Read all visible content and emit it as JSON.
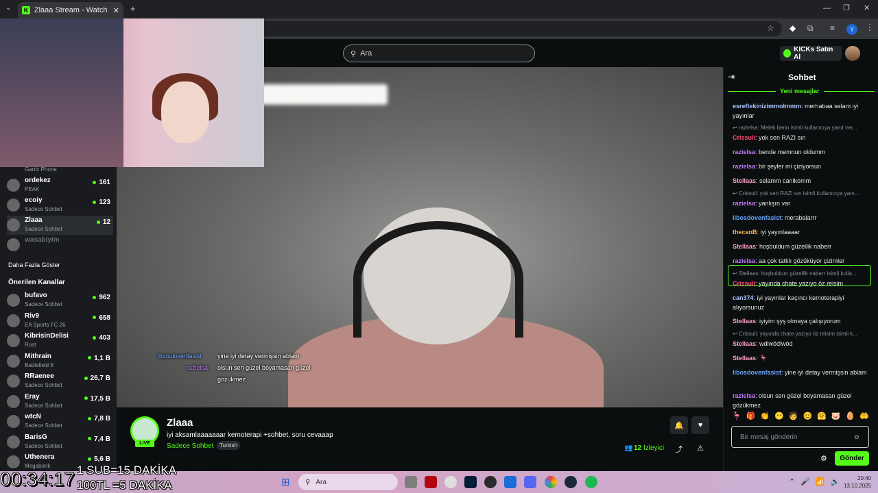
{
  "browser": {
    "tab_title": "Zlaaa Stream - Watch Live o",
    "new_tab": "+",
    "profile": "Y"
  },
  "header": {
    "search_placeholder": "Ara",
    "kicks_button": "KICKs Satın Al"
  },
  "sidebar": {
    "top_partial_game": "Gartic Phone",
    "followed": [
      {
        "name": "ordekez",
        "game": "PEAK",
        "viewers": "161"
      },
      {
        "name": "ecoiy",
        "game": "Sadece Sohbet",
        "viewers": "123"
      },
      {
        "name": "Zlaaa",
        "game": "Sadece Sohbet",
        "viewers": "12"
      },
      {
        "name": "wasabiyim",
        "game": "",
        "viewers": ""
      }
    ],
    "show_more": "Daha Fazla Göster",
    "recommended_title": "Önerilen Kanallar",
    "recommended": [
      {
        "name": "bufavo",
        "game": "Sadece Sohbet",
        "viewers": "962"
      },
      {
        "name": "Riv9",
        "game": "EA Sports FC 26",
        "viewers": "658"
      },
      {
        "name": "KibrisinDelisi",
        "game": "Rust",
        "viewers": "403"
      },
      {
        "name": "Mithrain",
        "game": "Battlefield 6",
        "viewers": "1,1 B"
      },
      {
        "name": "RRaenee",
        "game": "Sadece Sohbet",
        "viewers": "26,7 B"
      },
      {
        "name": "Eray",
        "game": "Sadece Sohbet",
        "viewers": "17,5 B"
      },
      {
        "name": "wtcN",
        "game": "Sadece Sohbet",
        "viewers": "7,8 B"
      },
      {
        "name": "BarisG",
        "game": "Sadece Sohbet",
        "viewers": "7,4 B"
      },
      {
        "name": "Uthenera",
        "game": "Megabonk",
        "viewers": "5,6 B"
      }
    ]
  },
  "video_overlay_chat": [
    {
      "user": "libosdovenfasist",
      "text": "yine iyi detay vermişsin ablam"
    },
    {
      "user": "razielsa",
      "text": "olsun sen güzel boyamasan güzel"
    },
    {
      "user": "",
      "text": "gozukmez"
    }
  ],
  "stream": {
    "name": "Zlaaa",
    "title": "iyi aksamlaaaaaaar kemoterapi +sohbet, soru cevaaap",
    "category": "Sadece Sohbet",
    "tag": "Turkish",
    "live": "LIVE",
    "viewers": "12",
    "viewers_label": "İzleyici"
  },
  "chat": {
    "title": "Sohbet",
    "new_messages": "Yeni mesajlar",
    "messages": [
      {
        "user": "esreftekinizimmolmmm",
        "color": "#a9c4ff",
        "text": "merhabaa selam iyi yayınlar"
      },
      {
        "reply": "razielsa: Melek benn isimli kullanıcıya yanıt ver..."
      },
      {
        "user": "Crissuli",
        "color": "#ff4d7a",
        "text": "yok sen RAZI sın"
      },
      {
        "user": "razielsa",
        "color": "#c57bff",
        "text": "bende memnun oldumm"
      },
      {
        "user": "razielsa",
        "color": "#c57bff",
        "text": "bir şeyler mi çiziyorsun"
      },
      {
        "user": "Stellaas",
        "color": "#ff9ec4",
        "text": "selamm canikomm"
      },
      {
        "reply": "Crissuli: yok sen RAZI sın isimli kullanıcıya yanı..."
      },
      {
        "user": "razielsa",
        "color": "#c57bff",
        "text": "yanlışın var"
      },
      {
        "user": "libosdovenfasist",
        "color": "#6aa7ff",
        "text": "merabalarrr"
      },
      {
        "user": "thecanB",
        "color": "#ffb347",
        "text": "iyi yayınlaaaar"
      },
      {
        "user": "Stellaas",
        "color": "#ff9ec4",
        "text": "hoşbuldum güzellik naberr"
      },
      {
        "user": "razielsa",
        "color": "#c57bff",
        "text": "aa çok tatklı gözüküyor çizimler"
      },
      {
        "reply": "Stellaas: hoşbuldum güzellik naberr isimli kulla..."
      },
      {
        "user": "Crissuli",
        "color": "#ff4d7a",
        "text": "yayında chate yazıyo öz reisim"
      },
      {
        "user": "can374",
        "color": "#a9c4ff",
        "text": "iyi yayınlar kaçıncı kemoterapiyi alıyorsunuz"
      },
      {
        "user": "Stellaas",
        "color": "#ff9ec4",
        "text": "iyiyim şyş olmaya çalışıyorum"
      },
      {
        "reply": "Crissuli: yayında chate yazıyo öz reisim isimli k..."
      },
      {
        "user": "Stellaas",
        "color": "#ff9ec4",
        "text": "wdlwödlwöd"
      },
      {
        "user": "Stellaas",
        "color": "#ff9ec4",
        "text": "🦩"
      },
      {
        "user": "libosdovenfasist",
        "color": "#6aa7ff",
        "text": "yine iyi detay vermişsin ablam"
      },
      {
        "user": "razielsa",
        "color": "#c57bff",
        "text": "olsun sen güzel boyamasan güzel gözükmez"
      }
    ],
    "input_placeholder": "Bir mesaj gönderin",
    "send_label": "Gönder"
  },
  "overlay": {
    "timer": "00:34:17",
    "line1": "1 SUB=15 DAKİKA",
    "line2": "100TL =5 DAKİKA"
  },
  "taskbar": {
    "search_label": "Ara",
    "time": "20:40",
    "date": "13.10.2025"
  },
  "colors": {
    "kick_green": "#53fc18",
    "bg": "#0b0e0f"
  }
}
